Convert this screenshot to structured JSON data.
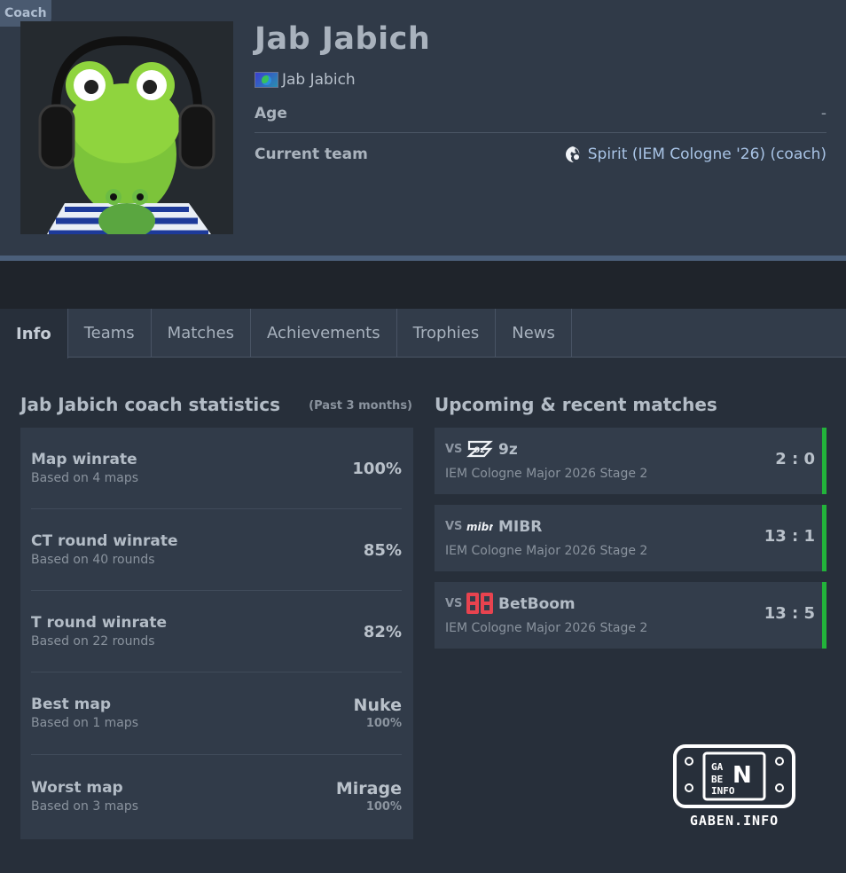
{
  "header": {
    "role_badge": "Coach",
    "player_name": "Jab Jabich",
    "nickname": "Jab Jabich",
    "age_label": "Age",
    "age_value": "-",
    "team_label": "Current team",
    "team_value": "Spirit (IEM Cologne '26) (coach)"
  },
  "tabs": [
    "Info",
    "Teams",
    "Matches",
    "Achievements",
    "Trophies",
    "News"
  ],
  "stats": {
    "title": "Jab Jabich coach statistics",
    "period": "(Past 3 months)",
    "items": [
      {
        "label": "Map winrate",
        "sub": "Based on 4 maps",
        "value": "100%"
      },
      {
        "label": "CT round winrate",
        "sub": "Based on 40 rounds",
        "value": "85%"
      },
      {
        "label": "T round winrate",
        "sub": "Based on 22 rounds",
        "value": "82%"
      },
      {
        "label": "Best map",
        "sub": "Based on 1 maps",
        "value": "Nuke",
        "pct": "100%"
      },
      {
        "label": "Worst map",
        "sub": "Based on 3 maps",
        "value": "Mirage",
        "pct": "100%"
      }
    ]
  },
  "matches": {
    "title": "Upcoming & recent matches",
    "items": [
      {
        "vs": "VS",
        "team": "9z",
        "event": "IEM Cologne Major 2026 Stage 2",
        "score": "2 : 0",
        "logo": "9z-logo-icon"
      },
      {
        "vs": "VS",
        "team": "MIBR",
        "event": "IEM Cologne Major 2026 Stage 2",
        "score": "13 : 1",
        "logo": "mibr-logo-icon"
      },
      {
        "vs": "VS",
        "team": "BetBoom",
        "event": "IEM Cologne Major 2026 Stage 2",
        "score": "13 : 5",
        "logo": "betboom-logo-icon"
      }
    ]
  },
  "watermark": {
    "logo_letters": [
      "GA",
      "N",
      "BE",
      "INFO"
    ],
    "text": "GABEN.INFO"
  },
  "colors": {
    "win_bar": "#22b33a",
    "team_link": "#a9c4e6",
    "background": "#272f3a"
  }
}
